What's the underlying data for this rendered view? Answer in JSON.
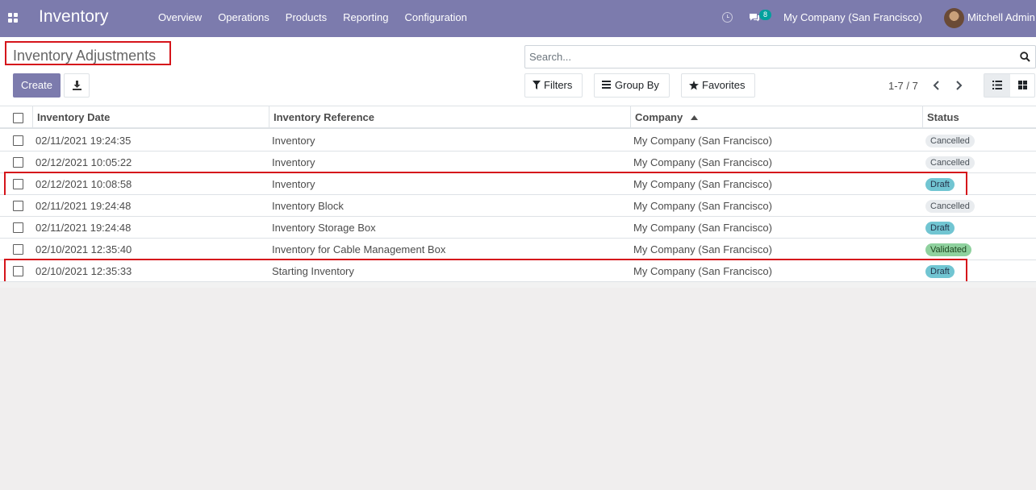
{
  "navbar": {
    "app_name": "Inventory",
    "menu": [
      "Overview",
      "Operations",
      "Products",
      "Reporting",
      "Configuration"
    ],
    "message_count": "8",
    "company": "My Company (San Francisco)",
    "user": "Mitchell Admin",
    "brand_color": "#7c7bad"
  },
  "control_panel": {
    "title": "Inventory Adjustments",
    "create_label": "Create",
    "search_placeholder": "Search...",
    "filters_label": "Filters",
    "group_by_label": "Group By",
    "favorites_label": "Favorites",
    "pager": "1-7 / 7"
  },
  "table": {
    "columns": [
      "Inventory Date",
      "Inventory Reference",
      "Company",
      "Status"
    ],
    "sorted_column": "Company",
    "rows": [
      {
        "date": "02/11/2021 19:24:35",
        "reference": "Inventory",
        "company": "My Company (San Francisco)",
        "status": "Cancelled",
        "status_key": "cancelled"
      },
      {
        "date": "02/12/2021 10:05:22",
        "reference": "Inventory",
        "company": "My Company (San Francisco)",
        "status": "Cancelled",
        "status_key": "cancelled"
      },
      {
        "date": "02/12/2021 10:08:58",
        "reference": "Inventory",
        "company": "My Company (San Francisco)",
        "status": "Draft",
        "status_key": "draft",
        "highlighted": true
      },
      {
        "date": "02/11/2021 19:24:48",
        "reference": "Inventory Block",
        "company": "My Company (San Francisco)",
        "status": "Cancelled",
        "status_key": "cancelled"
      },
      {
        "date": "02/11/2021 19:24:48",
        "reference": "Inventory Storage Box",
        "company": "My Company (San Francisco)",
        "status": "Draft",
        "status_key": "draft"
      },
      {
        "date": "02/10/2021 12:35:40",
        "reference": "Inventory for Cable Management Box",
        "company": "My Company (San Francisco)",
        "status": "Validated",
        "status_key": "validated"
      },
      {
        "date": "02/10/2021 12:35:33",
        "reference": "Starting Inventory",
        "company": "My Company (San Francisco)",
        "status": "Draft",
        "status_key": "draft",
        "highlighted": true
      }
    ]
  }
}
